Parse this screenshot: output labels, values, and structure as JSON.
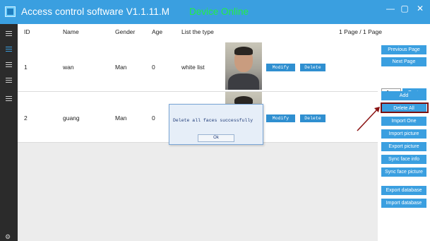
{
  "window": {
    "title": "Access control software V1.1.11.M",
    "device_status": "Device Online",
    "controls": {
      "minimize": "—",
      "maximize": "▢",
      "close": "✕"
    }
  },
  "table": {
    "headers": {
      "id": "ID",
      "name": "Name",
      "gender": "Gender",
      "age": "Age",
      "list_type": "List the type"
    },
    "page_info": "1 Page / 1 Page",
    "rows": [
      {
        "id": "1",
        "name": "wan",
        "gender": "Man",
        "age": "0",
        "list_type": "white list",
        "modify": "Modify",
        "delete": "Delete"
      },
      {
        "id": "2",
        "name": "guang",
        "gender": "Man",
        "age": "0",
        "list_type": "",
        "modify": "Modify",
        "delete": "Delete"
      }
    ]
  },
  "right_panel": {
    "previous_page": "Previous Page",
    "next_page": "Next Page",
    "page_input": "1",
    "go_to": "Go to",
    "add": "Add",
    "delete_all": "Delete All",
    "import_one": "Import One",
    "import_picture": "Import picture",
    "export_picture": "Export picture",
    "sync_face_info": "Sync face info",
    "sync_face_picture": "Sync face picture",
    "export_database": "Export database",
    "import_database": "Import database"
  },
  "dialog": {
    "message": "Delete all faces successfully",
    "ok": "Ok"
  },
  "colors": {
    "titlebar": "#3a9fe0",
    "status_online": "#22ee44",
    "button": "#3a9fe0",
    "highlight": "#7a1010",
    "sidebar": "#2b2b2b"
  },
  "icons": [
    "app-icon",
    "user-icon",
    "list-icon",
    "settings-icon"
  ]
}
